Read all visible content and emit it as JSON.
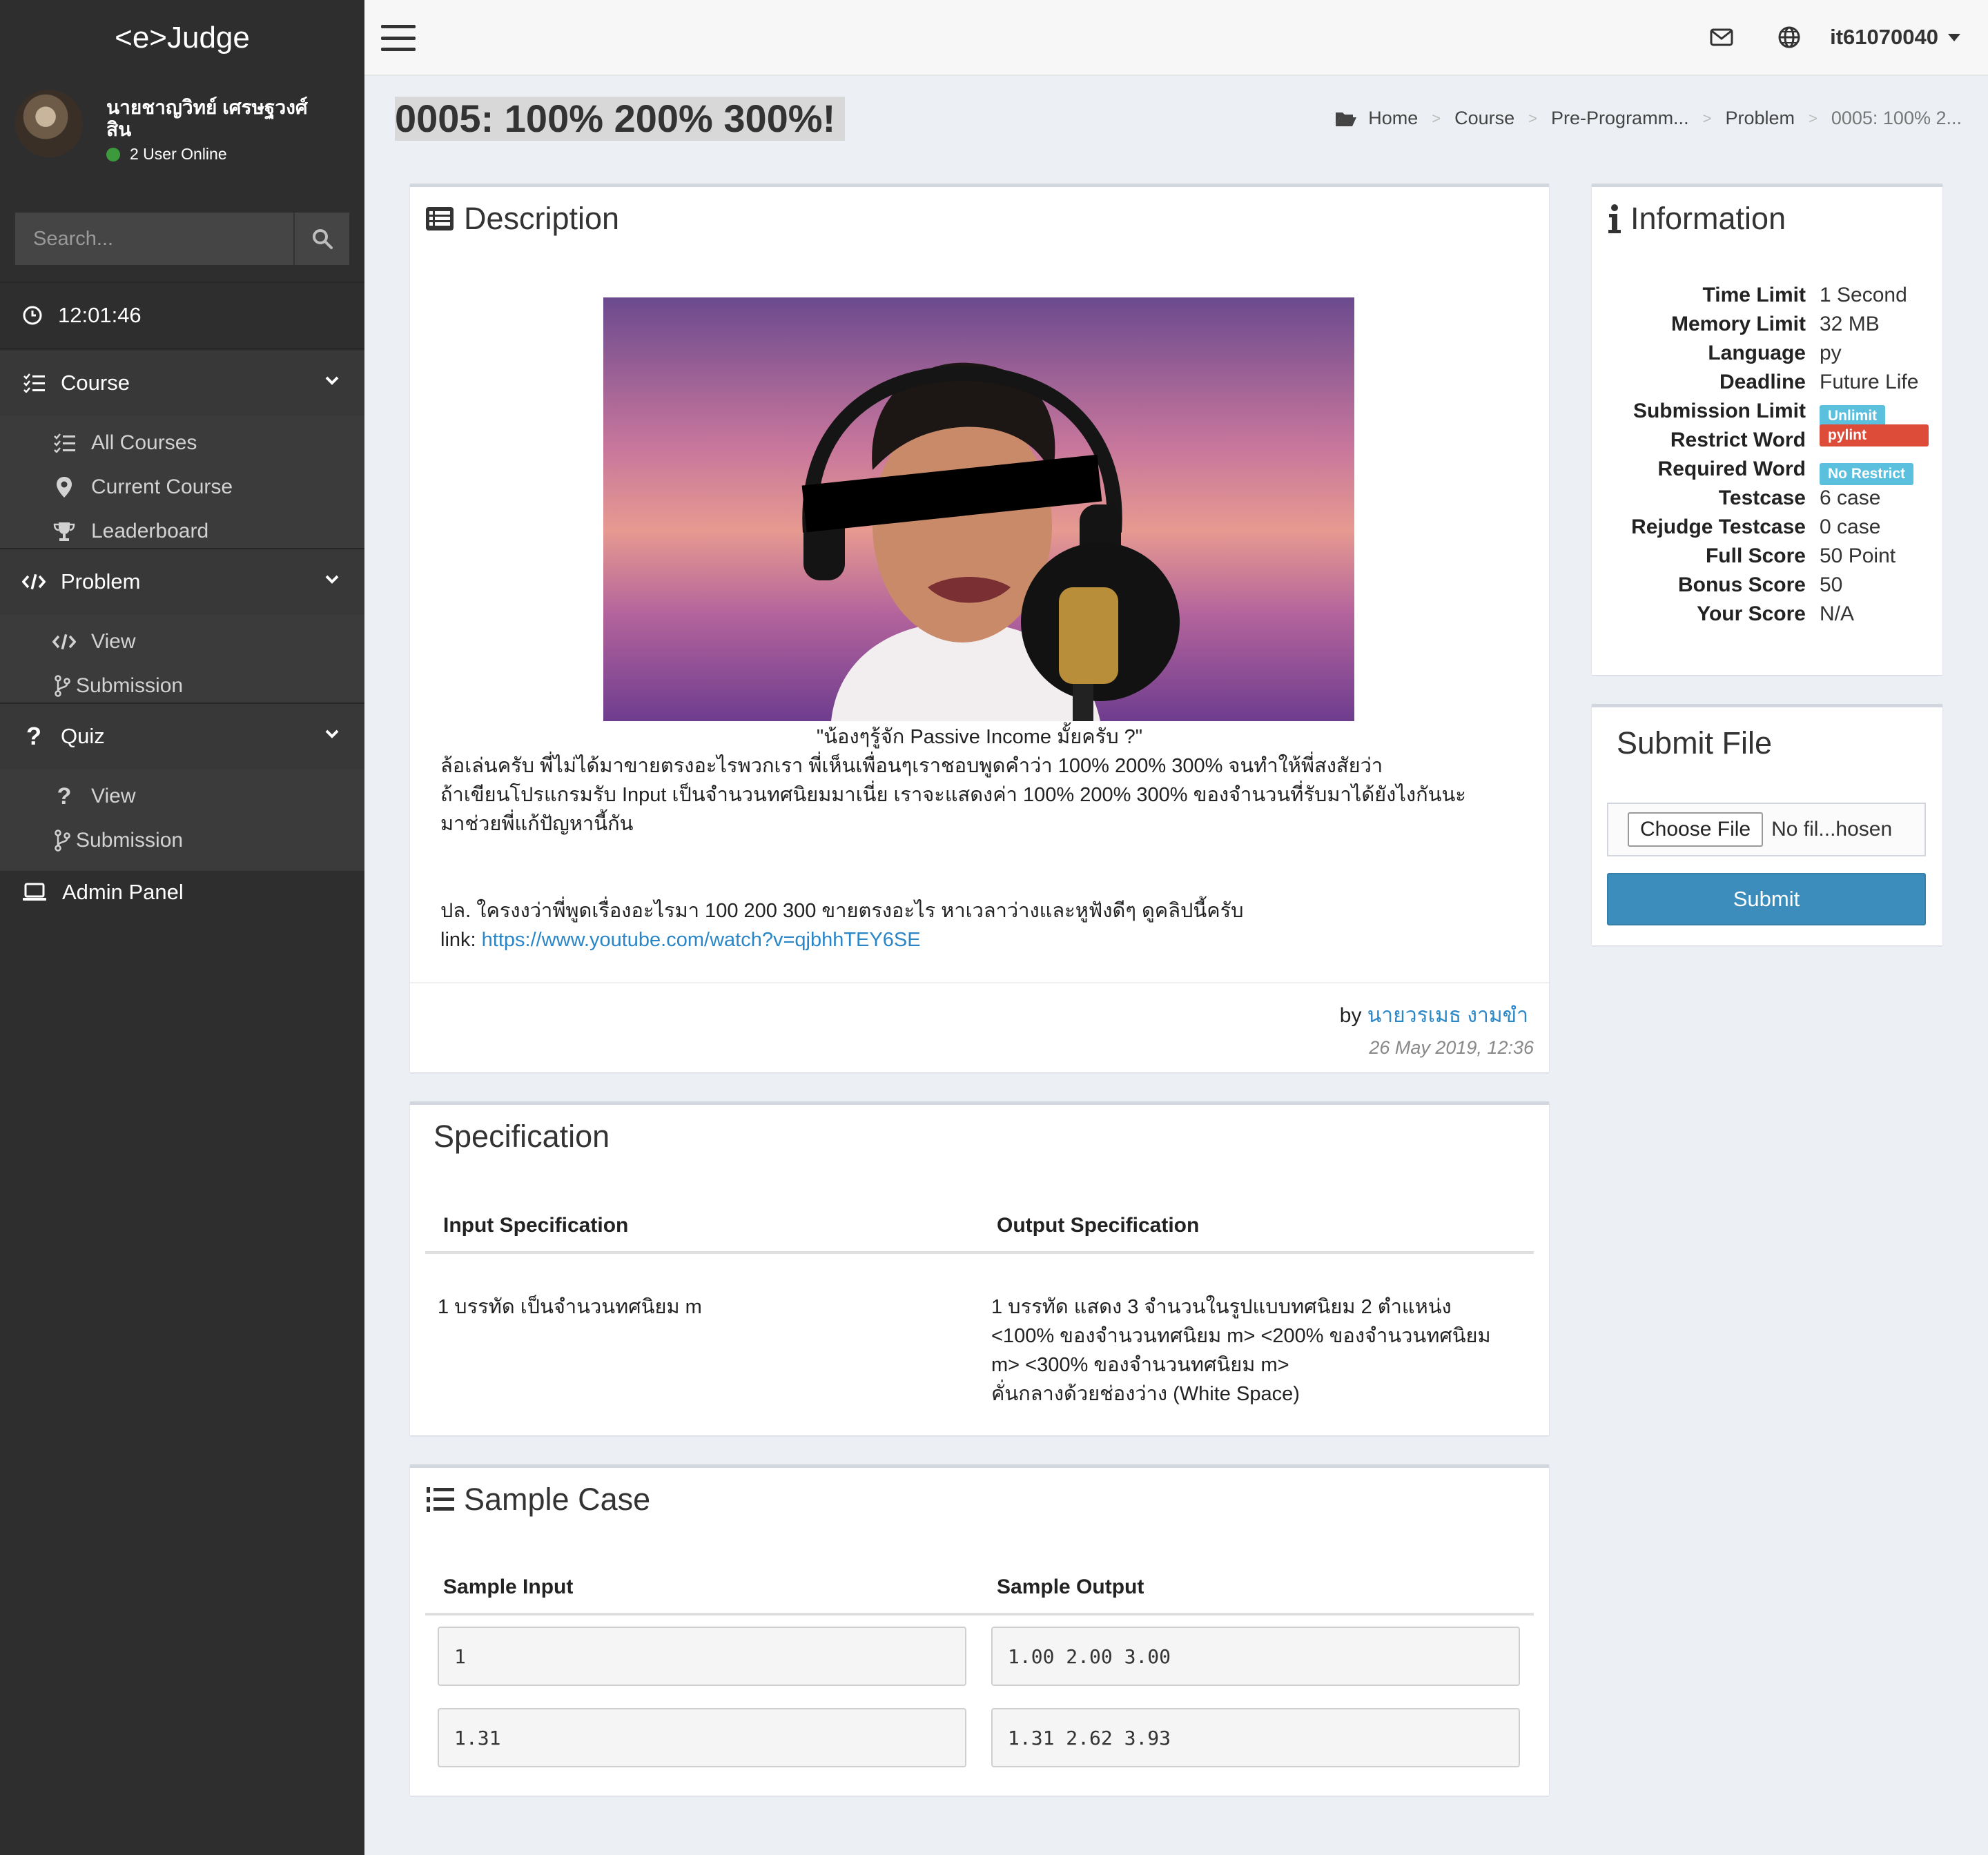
{
  "app": {
    "brand": "<e>Judge"
  },
  "user": {
    "name_line1": "นายชาญวิทย์ เศรษฐวงศ์",
    "name_line2": "สิน",
    "online_text": "2 User Online"
  },
  "sidebar": {
    "search_placeholder": "Search...",
    "clock": "12:01:46",
    "course": {
      "label": "Course",
      "items": [
        "All Courses",
        "Current Course",
        "Leaderboard"
      ]
    },
    "problem": {
      "label": "Problem",
      "items": [
        "View",
        "Submission"
      ]
    },
    "quiz": {
      "label": "Quiz",
      "items": [
        "View",
        "Submission"
      ]
    },
    "admin": "Admin Panel"
  },
  "topbar": {
    "username": "it61070040"
  },
  "page": {
    "title": "0005: 100% 200% 300%!"
  },
  "breadcrumb": [
    "Home",
    "Course",
    "Pre-Programm...",
    "Problem",
    "0005: 100% 2..."
  ],
  "description": {
    "title": "Description",
    "caption": "\"น้องๆรู้จัก Passive Income มั้ยครับ ?\"",
    "lines": [
      "   ล้อเล่นครับ พี่ไม่ได้มาขายตรงอะไรพวกเรา พี่เห็นเพื่อนๆเราชอบพูดคำว่า 100% 200% 300% จนทำให้พี่สงสัยว่า",
      "ถ้าเขียนโปรแกรมรับ Input เป็นจำนวนทศนิยมมาเนี่ย เราจะแสดงค่า 100% 200% 300% ของจำนวนที่รับมาได้ยังไงกันนะ",
      "มาช่วยพี่แก้ปัญหานี้กัน"
    ],
    "ps_line": "ปล. ใครงงว่าพี่พูดเรื่องอะไรมา 100 200 300 ขายตรงอะไร หาเวลาว่างและหูฟังดีๆ ดูคลิปนี้ครับ",
    "link_prefix": "link: ",
    "link": "https://www.youtube.com/watch?v=qjbhhTEY6SE",
    "by_prefix": "by ",
    "author": "นายวรเมธ งามขำ",
    "date": "26 May 2019, 12:36"
  },
  "information": {
    "title": "Information",
    "rows": [
      {
        "key": "Time Limit",
        "value": "1 Second"
      },
      {
        "key": "Memory Limit",
        "value": "32 MB"
      },
      {
        "key": "Language",
        "value": "py"
      },
      {
        "key": "Deadline",
        "value": "Future Life"
      },
      {
        "key": "Submission Limit",
        "badge": "Unlimit"
      },
      {
        "key": "Restrict Word",
        "badge": "pylint"
      },
      {
        "key": "Required Word",
        "badge": "No Restrict"
      },
      {
        "key": "Testcase",
        "value": "6 case"
      },
      {
        "key": "Rejudge Testcase",
        "value": "0 case"
      },
      {
        "key": "Full Score",
        "value": "50 Point"
      },
      {
        "key": "Bonus Score",
        "value": "50"
      },
      {
        "key": "Your Score",
        "value": "N/A"
      }
    ],
    "colors": {
      "info_badge": "#5bc0de",
      "danger_badge": "#dd4b39"
    }
  },
  "submit_file": {
    "title": "Submit File",
    "choose_label": "Choose File",
    "file_status": "No fil...hosen",
    "submit_label": "Submit"
  },
  "specification": {
    "title": "Specification",
    "input_header": "Input Specification",
    "output_header": "Output Specification",
    "input_text": "1 บรรทัด เป็นจำนวนทศนิยม m",
    "output_lines": [
      "1 บรรทัด แสดง 3 จำนวนในรูปแบบทศนิยม 2 ตำแหน่ง",
      "<100% ของจำนวนทศนิยม m> <200% ของจำนวนทศนิยม",
      "m> <300% ของจำนวนทศนิยม m>",
      "คั่นกลางด้วยช่องว่าง (White Space)"
    ]
  },
  "sample": {
    "title": "Sample Case",
    "input_header": "Sample Input",
    "output_header": "Sample Output",
    "cases": [
      {
        "input": "1",
        "output": "1.00 2.00 3.00"
      },
      {
        "input": "1.31",
        "output": "1.31 2.62 3.93"
      }
    ]
  }
}
